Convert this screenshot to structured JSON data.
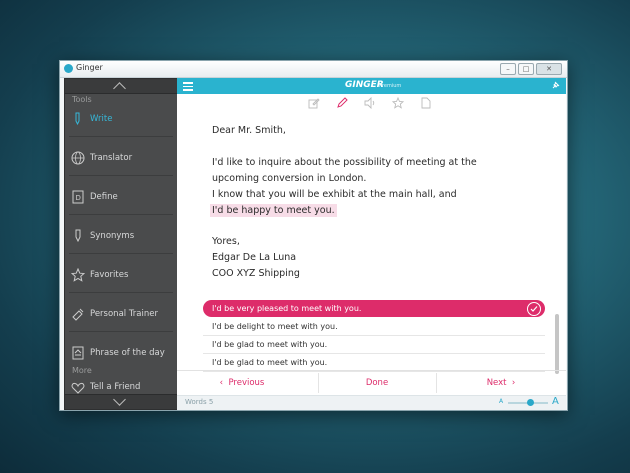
{
  "window": {
    "title": "Ginger",
    "controls": {
      "minimize": "–",
      "maximize": "□",
      "close": "✕"
    }
  },
  "sidebar": {
    "tools_header": "Tools",
    "more_header": "More",
    "items": [
      {
        "label": "Write",
        "icon": "pen-icon",
        "active": true
      },
      {
        "label": "Translator",
        "icon": "globe-icon",
        "active": false
      },
      {
        "label": "Define",
        "icon": "dictionary-icon",
        "active": false
      },
      {
        "label": "Synonyms",
        "icon": "synonyms-icon",
        "active": false
      },
      {
        "label": "Favorites",
        "icon": "star-icon",
        "active": false
      },
      {
        "label": "Personal Trainer",
        "icon": "trainer-icon",
        "active": false
      },
      {
        "label": "Phrase of the day",
        "icon": "phrase-icon",
        "active": false
      },
      {
        "label": "Tell a Friend",
        "icon": "heart-icon",
        "active": false
      }
    ]
  },
  "header": {
    "logo": "GINGER",
    "logo_sub": "Premium"
  },
  "document": {
    "lines": [
      "Dear Mr. Smith,",
      "I'd like to inquire about the possibility of meeting at the",
      "upcoming conversion in London.",
      "I know that you will be exhibit at the main hall, and",
      "I'd be happy to meet you.",
      "Yores,",
      "Edgar De La Luna",
      "COO XYZ Shipping"
    ]
  },
  "suggestions": [
    "I'd be very pleased to meet with you.",
    "I'd be delight to meet with you.",
    "I'd be glad to meet with you.",
    "I'd be glad to meet with you."
  ],
  "nav": {
    "previous": "Previous",
    "done": "Done",
    "next": "Next"
  },
  "status": {
    "words_label": "Words",
    "words_count": "5",
    "zoom_small": "A",
    "zoom_large": "A"
  },
  "colors": {
    "accent": "#2ab3cf",
    "highlight": "#dd2c6a",
    "sidebar": "#4a4b4c"
  }
}
